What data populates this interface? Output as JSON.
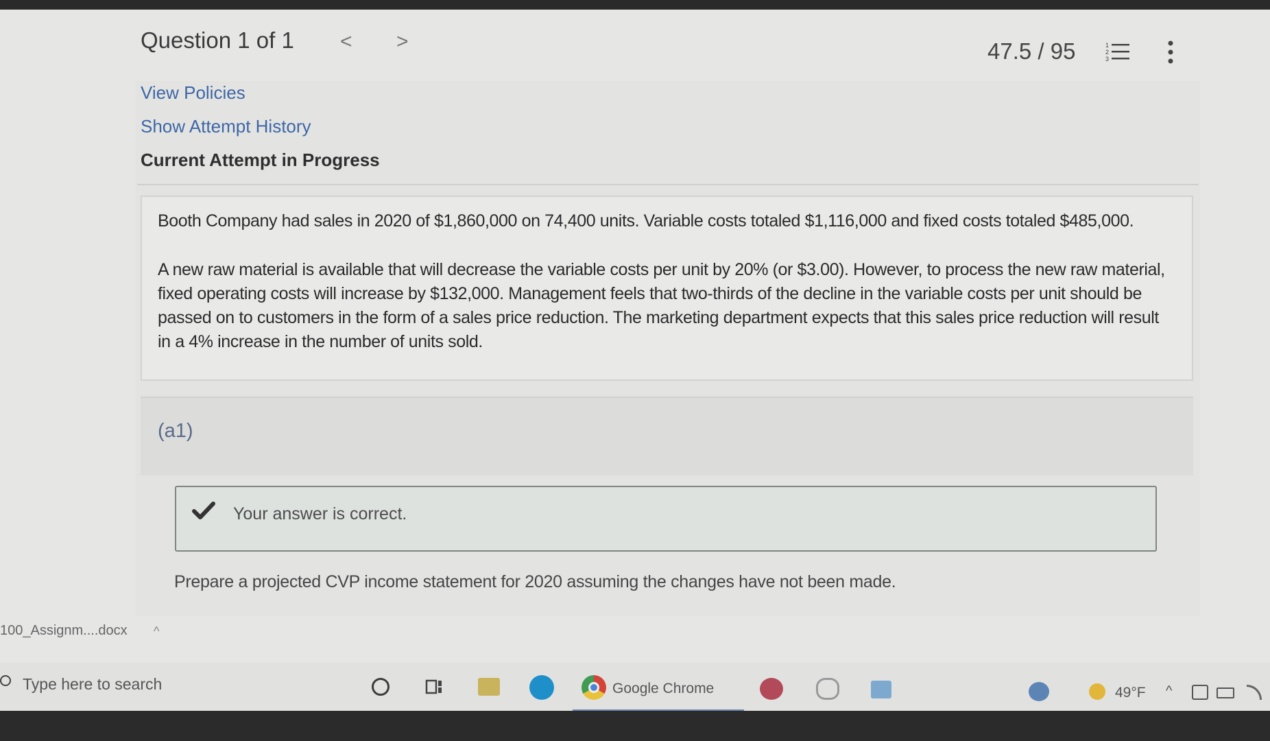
{
  "header": {
    "question_counter": "Question 1 of 1",
    "prev_symbol": "<",
    "next_symbol": ">",
    "score": "47.5 / 95"
  },
  "links": {
    "view_policies": "View Policies",
    "show_attempt_history": "Show Attempt History"
  },
  "attempt_status": "Current Attempt in Progress",
  "question": {
    "paragraph1": "Booth Company had sales in 2020 of $1,860,000 on 74,400 units. Variable costs totaled $1,116,000 and fixed costs totaled $485,000.",
    "paragraph2": "A new raw material is available that will decrease the variable costs per unit by 20% (or $3.00). However, to process the new raw material, fixed operating costs will increase by $132,000. Management feels that two-thirds of the decline in the variable costs per unit should be passed on to customers in the form of a sales price reduction. The marketing department expects that this sales price reduction will result in a 4% increase in the number of units sold."
  },
  "part": {
    "label": "(a1)",
    "feedback": "Your answer is correct.",
    "instruction": "Prepare a projected CVP income statement for 2020 assuming the changes have not been made."
  },
  "download_bar": {
    "file_name": "100_Assignm....docx",
    "caret": "^"
  },
  "taskbar": {
    "search_placeholder": "Type here to search",
    "chrome_label": "Google Chrome",
    "weather_temp": "49°F",
    "tray_caret": "^"
  },
  "colors": {
    "link": "#3e66a6",
    "page_bg": "#e6e7e5",
    "success_border": "#7f8581"
  }
}
